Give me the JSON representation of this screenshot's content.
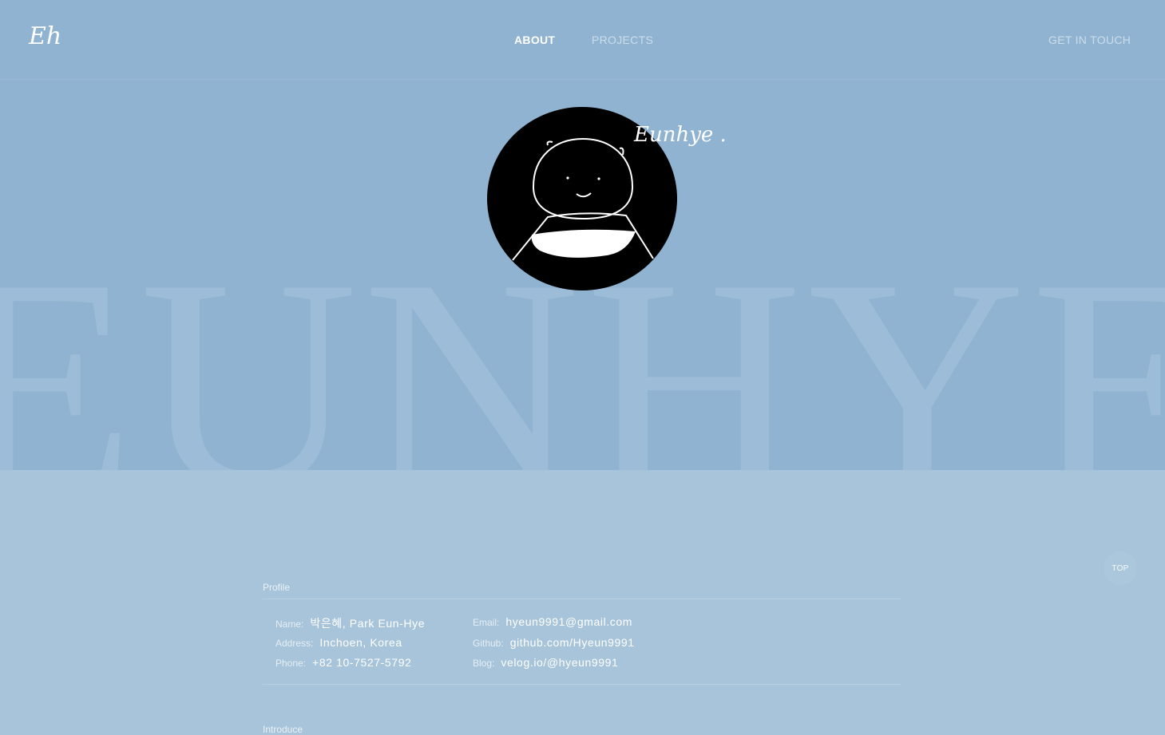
{
  "header": {
    "logo": "Eh",
    "nav": {
      "about": "ABOUT",
      "projects": "PROJECTS"
    },
    "contact": "GET IN TOUCH"
  },
  "hero": {
    "background_text": "EUNHYE",
    "signature": "Eunhye ."
  },
  "profile": {
    "section_label": "Profile",
    "left": [
      {
        "key": "Name:",
        "value": "박은혜, Park Eun-Hye"
      },
      {
        "key": "Address:",
        "value": "Inchoen, Korea"
      },
      {
        "key": "Phone:",
        "value": "+82 10-7527-5792"
      }
    ],
    "right": [
      {
        "key": "Email:",
        "value": "hyeun9991@gmail.com"
      },
      {
        "key": "Github:",
        "value": "github.com/Hyeun9991"
      },
      {
        "key": "Blog:",
        "value": "velog.io/@hyeun9991"
      }
    ]
  },
  "introduce": {
    "section_label": "Introduce"
  },
  "top_button": "TOP",
  "colors": {
    "hero_bg": "#8fb3d1",
    "page_bg": "#a7c4da",
    "text": "#ffffff"
  }
}
